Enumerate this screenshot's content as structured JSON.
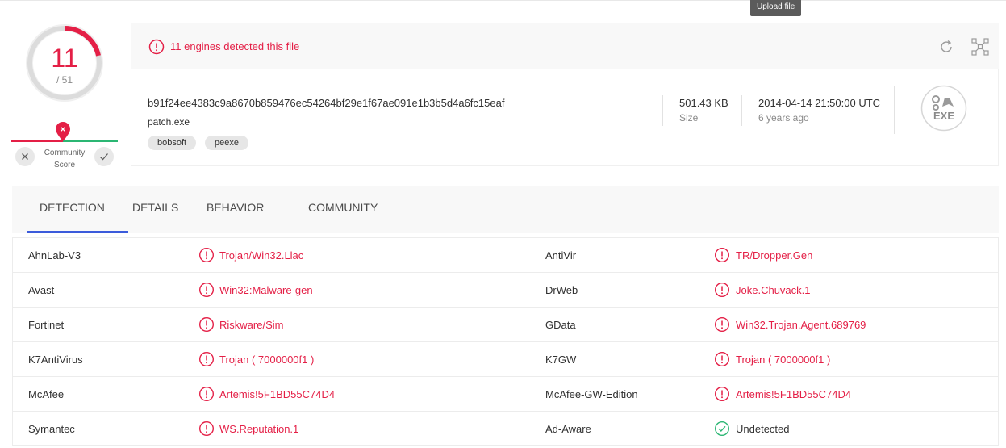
{
  "tooltip": "Upload file",
  "score": {
    "detections": "11",
    "total": "/ 51",
    "detections_value": 11,
    "total_value": 51,
    "ring_color": "#e41f46",
    "community_label_line1": "Community",
    "community_label_line2": "Score"
  },
  "alert": {
    "text": "11 engines detected this file",
    "color": "#e41f46"
  },
  "file": {
    "hash": "b91f24ee4383c9a8670b859476ec54264bf29e1f67ae091e1b3b5d4a6fc15eaf",
    "name": "patch.exe",
    "tags": [
      "bobsoft",
      "peexe"
    ],
    "size": "501.43 KB",
    "size_label": "Size",
    "date": "2014-04-14 21:50:00 UTC",
    "date_ago": "6 years ago",
    "type_label": "EXE"
  },
  "tabs": [
    "DETECTION",
    "DETAILS",
    "BEHAVIOR",
    "COMMUNITY"
  ],
  "active_tab": "DETECTION",
  "results": [
    {
      "left_engine": "AhnLab-V3",
      "left_result": "Trojan/Win32.Llac",
      "left_status": "malicious",
      "right_engine": "AntiVir",
      "right_result": "TR/Dropper.Gen",
      "right_status": "malicious"
    },
    {
      "left_engine": "Avast",
      "left_result": "Win32:Malware-gen",
      "left_status": "malicious",
      "right_engine": "DrWeb",
      "right_result": "Joke.Chuvack.1",
      "right_status": "malicious"
    },
    {
      "left_engine": "Fortinet",
      "left_result": "Riskware/Sim",
      "left_status": "malicious",
      "right_engine": "GData",
      "right_result": "Win32.Trojan.Agent.689769",
      "right_status": "malicious"
    },
    {
      "left_engine": "K7AntiVirus",
      "left_result": "Trojan ( 7000000f1 )",
      "left_status": "malicious",
      "right_engine": "K7GW",
      "right_result": "Trojan ( 7000000f1 )",
      "right_status": "malicious"
    },
    {
      "left_engine": "McAfee",
      "left_result": "Artemis!5F1BD55C74D4",
      "left_status": "malicious",
      "right_engine": "McAfee-GW-Edition",
      "right_result": "Artemis!5F1BD55C74D4",
      "right_status": "malicious"
    },
    {
      "left_engine": "Symantec",
      "left_result": "WS.Reputation.1",
      "left_status": "malicious",
      "right_engine": "Ad-Aware",
      "right_result": "Undetected",
      "right_status": "undetected"
    }
  ],
  "colors": {
    "malicious": "#e41f46",
    "undetected": "#2bb673",
    "tab_accent": "#3b5bdb"
  }
}
